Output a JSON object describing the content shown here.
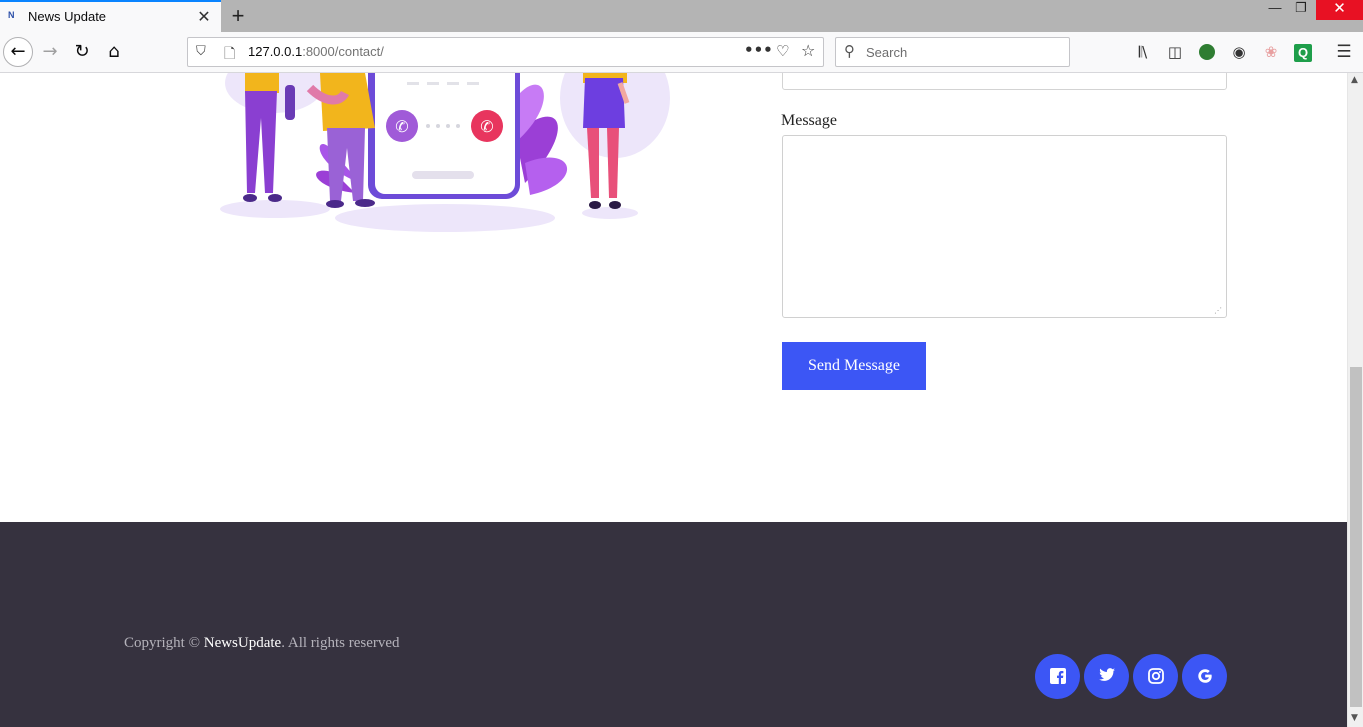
{
  "browser": {
    "tab_title": "News Update",
    "tab_favicon": "N",
    "close_tab_glyph": "✕",
    "new_tab_glyph": "+",
    "window": {
      "minimize": "—",
      "maximize": "❐",
      "close": "✕"
    },
    "url": {
      "host": "127.0.0.1",
      "rest": ":8000/contact/"
    },
    "search_placeholder": "Search",
    "icons": [
      "back-icon",
      "forward-icon",
      "reload-icon",
      "home-icon",
      "shield-icon",
      "page-icon",
      "more-icon",
      "pocket-icon",
      "bookmark-star-icon",
      "search-icon",
      "library-icon",
      "sidebar-icon",
      "extension-icon",
      "account-icon",
      "extension-icon",
      "extension-icon",
      "menu-icon"
    ]
  },
  "contact_form": {
    "message_label": "Message",
    "message_value": "",
    "send_button": "Send Message"
  },
  "footer": {
    "copyright_prefix": "Copyright © ",
    "brand": "NewsUpdate",
    "copyright_suffix": ". All rights reserved",
    "social": [
      "facebook-icon",
      "twitter-icon",
      "instagram-icon",
      "google-icon"
    ]
  },
  "colors": {
    "accent": "#3c56f5",
    "footer_bg": "#36323f",
    "illustration_purple": "#8a3fd1",
    "illustration_yellow": "#f2b51c",
    "illustration_pink": "#e8355e"
  }
}
